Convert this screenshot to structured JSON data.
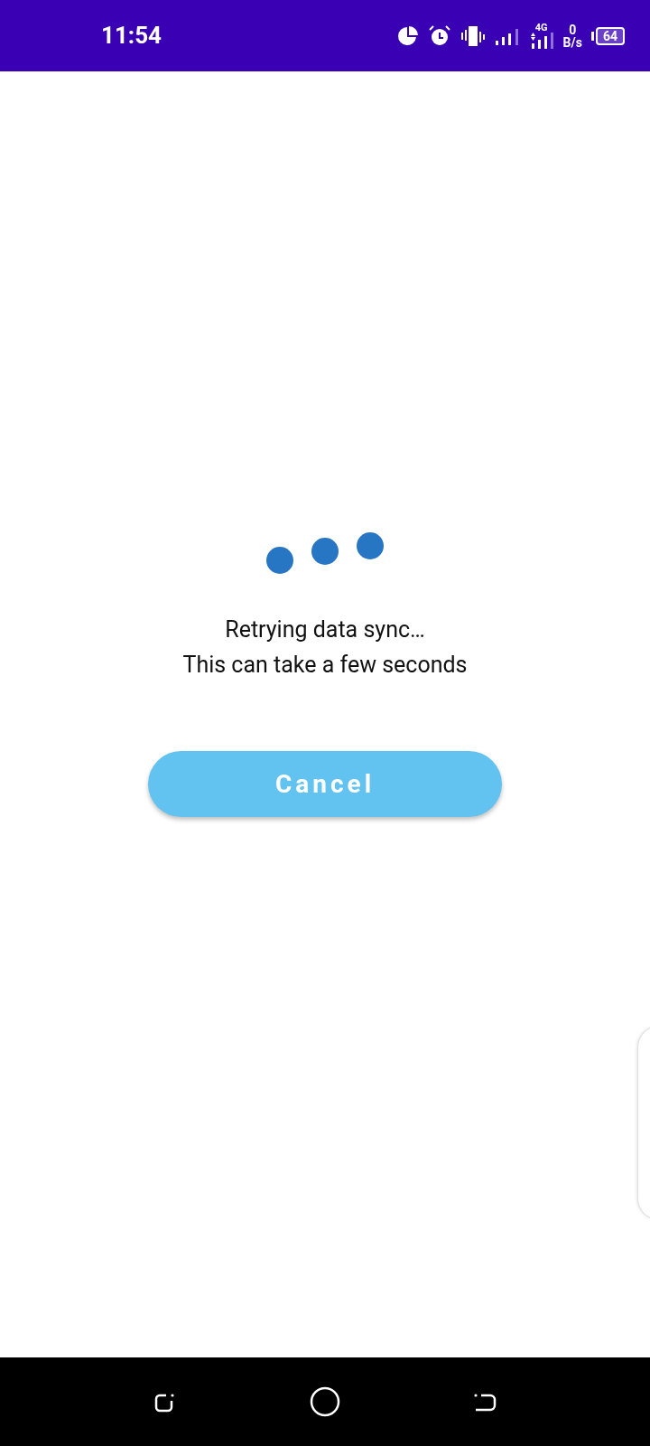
{
  "status_bar": {
    "time": "11:54",
    "network": "4G",
    "speed_value": "0",
    "speed_unit": "B/s",
    "battery": "64"
  },
  "loading": {
    "message_lines": [
      "Retrying data sync…",
      "This can take a few seconds"
    ]
  },
  "cancel_button": {
    "label": "Cancel"
  }
}
